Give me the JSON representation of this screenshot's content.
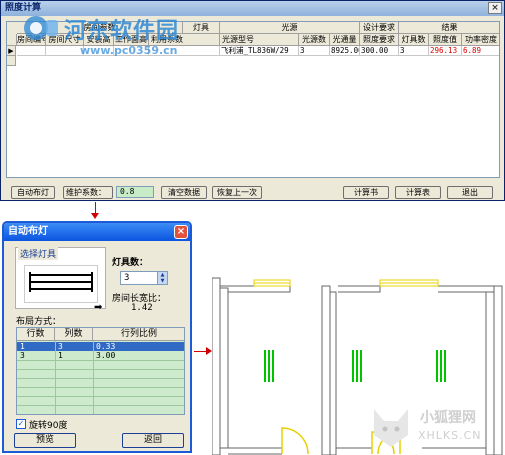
{
  "main_window": {
    "title": "照度计算",
    "close_glyph": "×",
    "header_groups": [
      "房间参数",
      "灯具",
      "光源",
      "设计要求",
      "结果"
    ],
    "columns": [
      "房间编号",
      "房间尺寸",
      "安装高",
      "工作面高",
      "利用系数",
      "光源型号",
      "光源数",
      "光通量",
      "照度要求",
      "灯具数",
      "照度值",
      "功率密度"
    ],
    "row_marker": "▶",
    "row": [
      "",
      "",
      "",
      "",
      "",
      "飞利浦_TL836W/29",
      "3",
      "8925.00",
      "300.00",
      "3",
      "296.13",
      "6.89"
    ],
    "buttons": {
      "auto_layout": "自动布灯",
      "maint_factor_label": "维护系数：",
      "maint_factor_value": "0.8",
      "clear_data": "清空数据",
      "restore_prev": "恢复上一次",
      "calc_book": "计算书",
      "calc_table": "计算表",
      "exit": "退出"
    }
  },
  "watermark": {
    "site_name": "河东软件园",
    "url": "www.pc0359.cn",
    "colors": {
      "blue": "#2a86d6"
    }
  },
  "auto_dialog": {
    "title": "自动布灯",
    "close_glyph": "×",
    "select_fixture_label": "选择灯具",
    "lamp_count_label": "灯具数：",
    "lamp_count_value": "3",
    "aspect_label": "房间长宽比：",
    "aspect_value": "1.42",
    "layout_label": "布局方式：",
    "list_columns": [
      "行数",
      "列数",
      "行列比例"
    ],
    "list_rows": [
      [
        "1",
        "3",
        "0.33"
      ],
      [
        "3",
        "1",
        "3.00"
      ]
    ],
    "rotate_label": "旋转90度",
    "rotate_checked": true,
    "preview_button": "预览",
    "back_button": "返回"
  },
  "corner_watermark": {
    "name": "小狐狸网",
    "domain": "XHLKS.CN"
  },
  "colors": {
    "connector_arrow": "#d00000",
    "lamp_green": "#00c400",
    "wall_yellow": "#e8d000",
    "result_red": "#e00000"
  }
}
